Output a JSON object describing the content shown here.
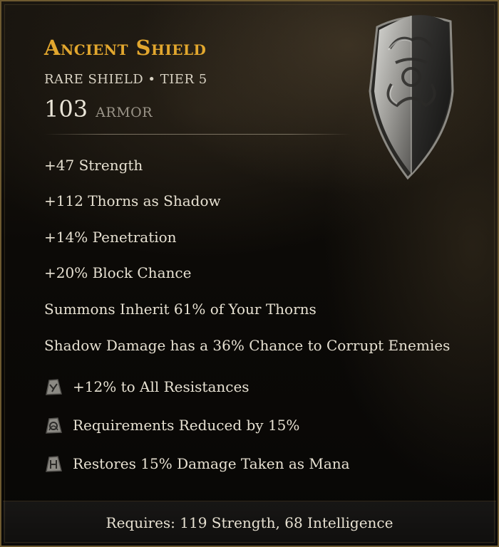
{
  "item": {
    "name": "Ancient Shield",
    "subtitle": "RARE SHIELD • TIER 5",
    "armor_value": "103",
    "armor_label": "ARMOR",
    "image_icon": "shield-icon",
    "affixes": [
      "+47 Strength",
      "+112 Thorns as Shadow",
      "+14% Penetration",
      "+20% Block Chance",
      "Summons Inherit 61% of Your Thorns",
      "Shadow Damage has a 36% Chance to Corrupt Enemies"
    ],
    "runes": [
      {
        "icon": "rune-icon",
        "text": "+12% to All Resistances"
      },
      {
        "icon": "rune-icon",
        "text": "Requirements Reduced by 15%"
      },
      {
        "icon": "rune-icon",
        "text": "Restores 15% Damage Taken as Mana"
      }
    ],
    "requirements": "Requires: 119 Strength, 68 Intelligence"
  },
  "colors": {
    "title": "#e2a72e",
    "text": "#e7e1d2",
    "muted": "#9a9488",
    "border": "#6e5a30"
  }
}
